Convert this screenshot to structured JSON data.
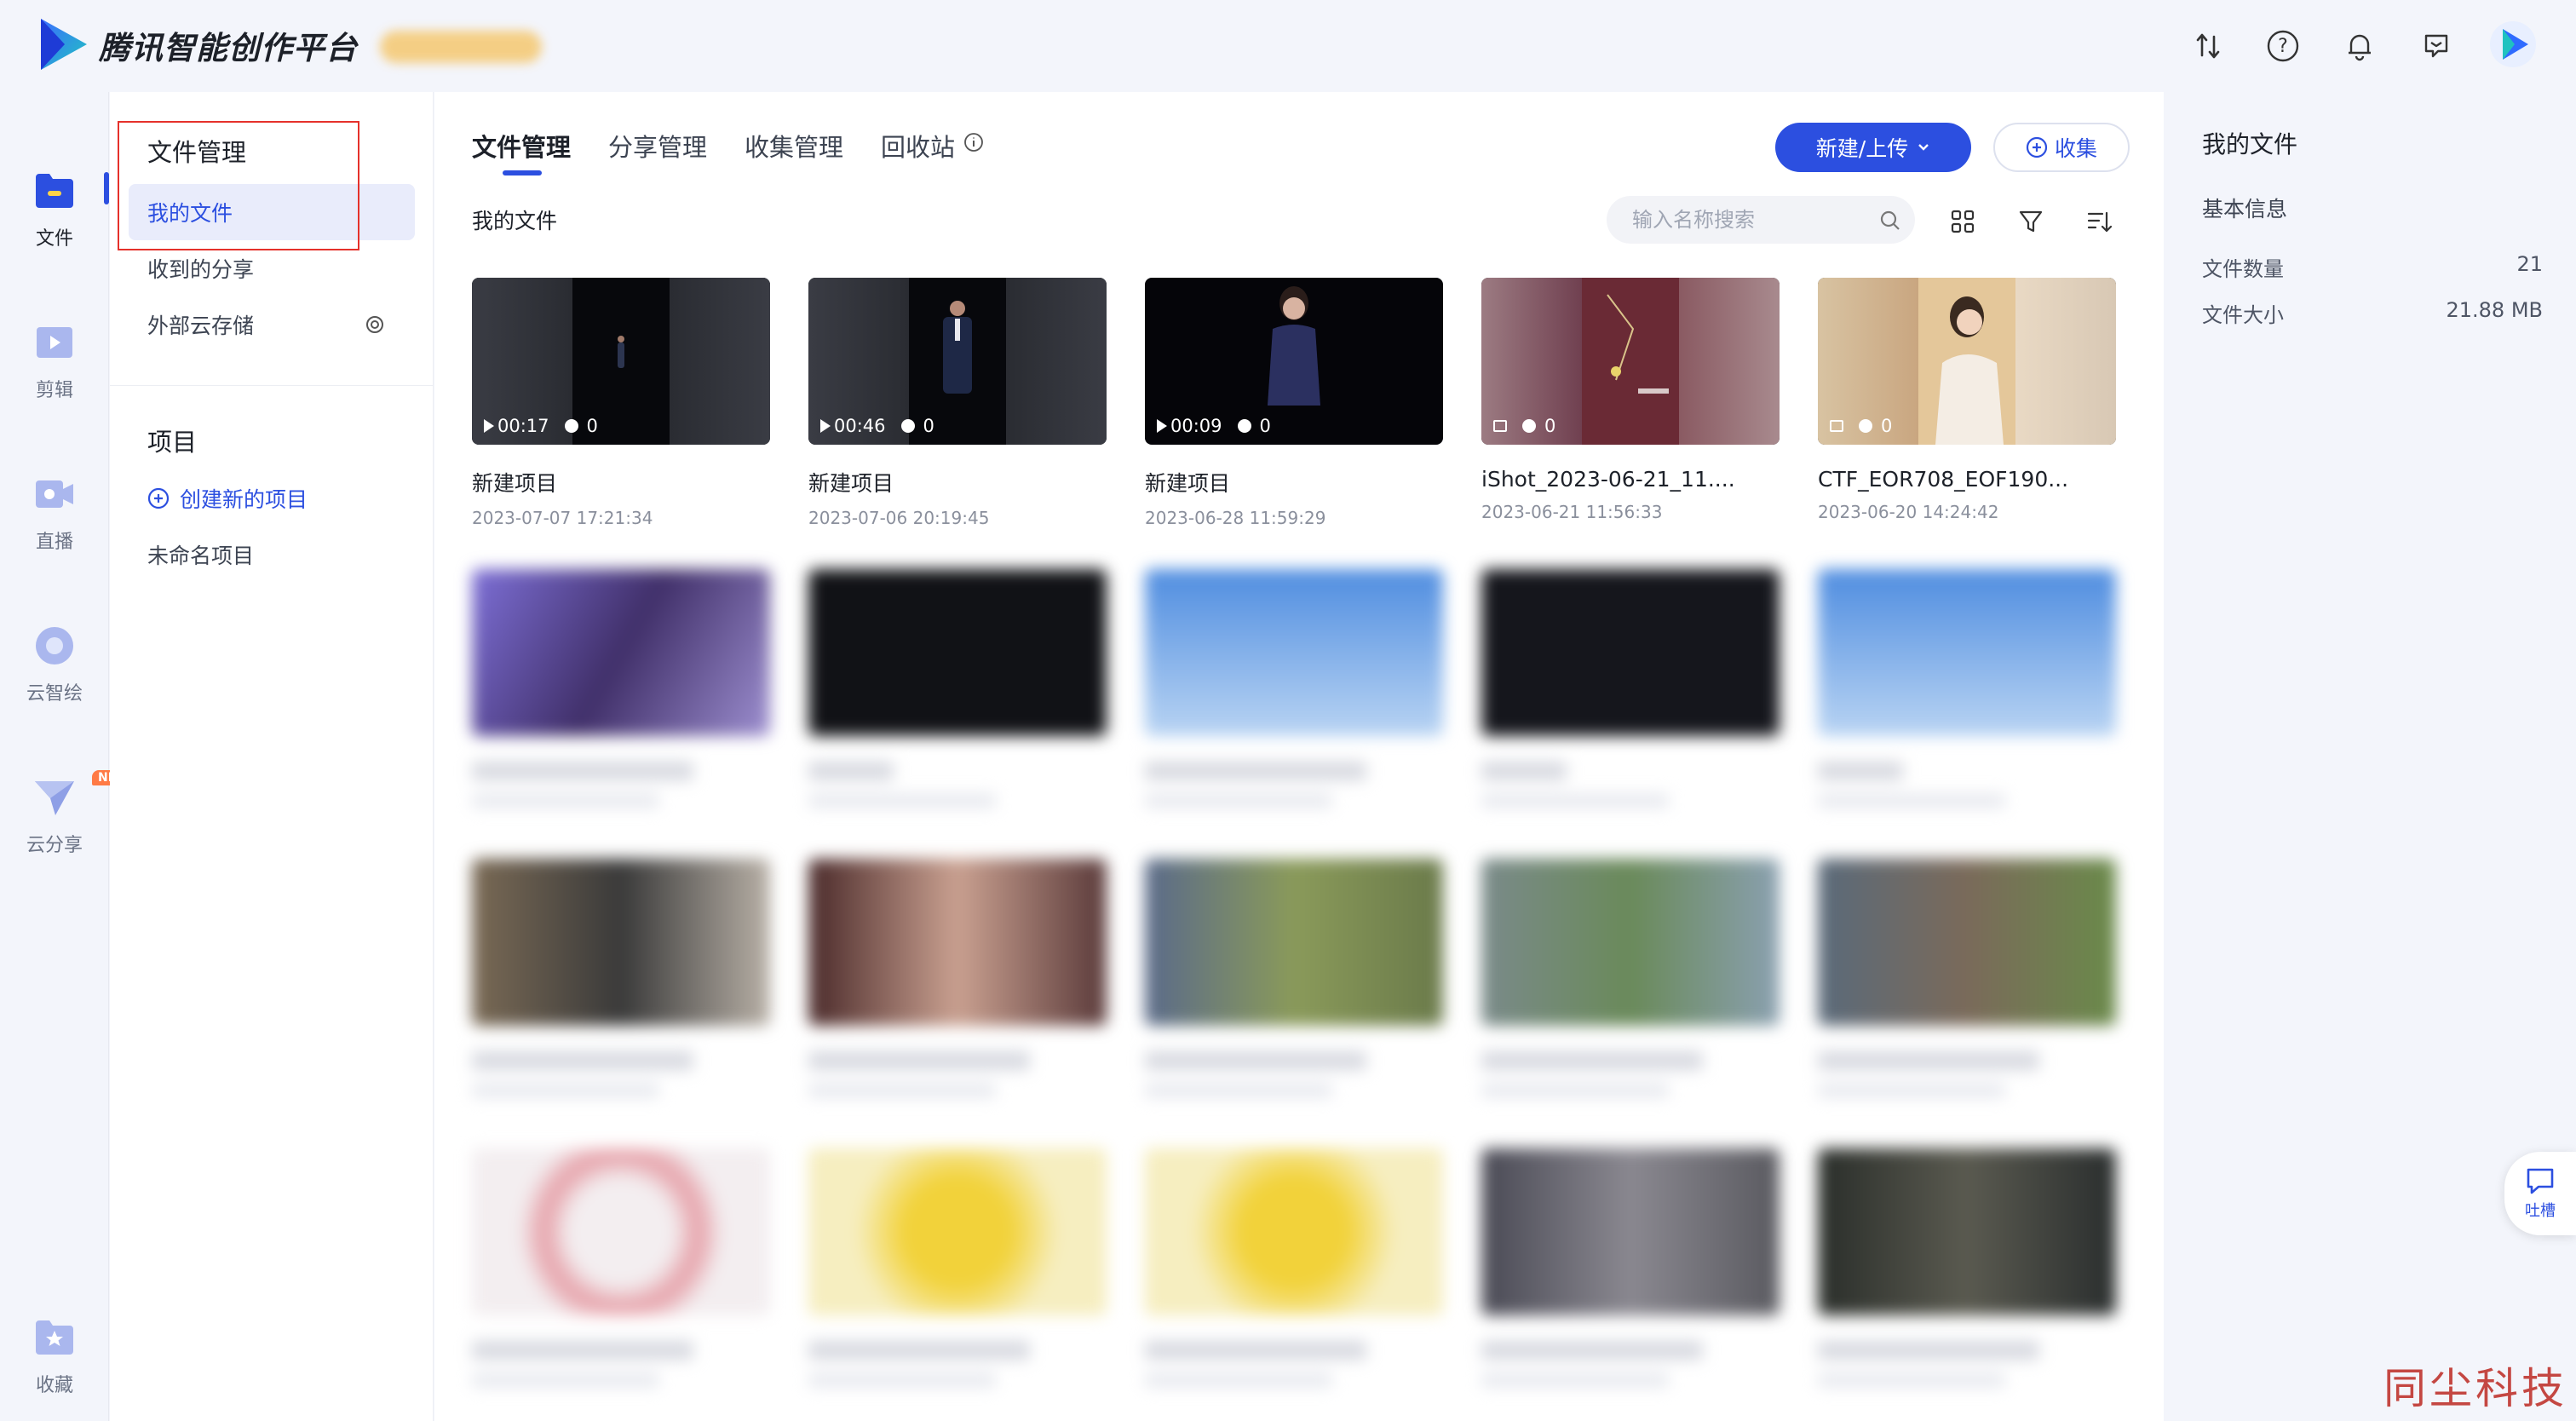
{
  "app": {
    "title": "腾讯智能创作平台"
  },
  "topbar": {
    "icons": [
      "sort-icon",
      "help-icon",
      "bell-icon",
      "message-icon",
      "avatar"
    ]
  },
  "rail": {
    "items": [
      {
        "label": "文件",
        "icon": "folder-icon",
        "active": true
      },
      {
        "label": "剪辑",
        "icon": "clip-icon"
      },
      {
        "label": "直播",
        "icon": "live-icon"
      },
      {
        "label": "云智绘",
        "icon": "paint-icon"
      },
      {
        "label": "云分享",
        "icon": "share-icon",
        "badge": "NEW"
      },
      {
        "label": "收藏",
        "icon": "favorite-icon"
      }
    ]
  },
  "side": {
    "section1_title": "文件管理",
    "items": [
      "我的文件",
      "收到的分享",
      "外部云存储"
    ],
    "section2_title": "项目",
    "create_project": "创建新的项目",
    "project_items": [
      "未命名项目"
    ]
  },
  "main": {
    "tabs": [
      "文件管理",
      "分享管理",
      "收集管理",
      "回收站"
    ],
    "new_upload_label": "新建/上传",
    "collect_label": "收集",
    "breadcrumb": "我的文件",
    "search_placeholder": "输入名称搜索",
    "cards": [
      {
        "name": "新建项目",
        "date": "2023-07-07 17:21:34",
        "duration": "00:17",
        "comments": "0",
        "type": "video"
      },
      {
        "name": "新建项目",
        "date": "2023-07-06 20:19:45",
        "duration": "00:46",
        "comments": "0",
        "type": "video"
      },
      {
        "name": "新建项目",
        "date": "2023-06-28 11:59:29",
        "duration": "00:09",
        "comments": "0",
        "type": "video"
      },
      {
        "name": "iShot_2023-06-21_11....",
        "date": "2023-06-21 11:56:33",
        "comments": "0",
        "type": "image"
      },
      {
        "name": "CTF_EOR708_EOF190...",
        "date": "2023-06-20 14:24:42",
        "comments": "0",
        "type": "image"
      }
    ]
  },
  "right_panel": {
    "title": "我的文件",
    "subtitle": "基本信息",
    "rows": [
      {
        "label": "文件数量",
        "value": "21"
      },
      {
        "label": "文件大小",
        "value": "21.88 MB"
      }
    ]
  },
  "feedback": {
    "label": "吐槽"
  },
  "watermark": "同尘科技",
  "colors": {
    "accent": "#2c4fe0",
    "highlight_frame": "#e5312b"
  }
}
